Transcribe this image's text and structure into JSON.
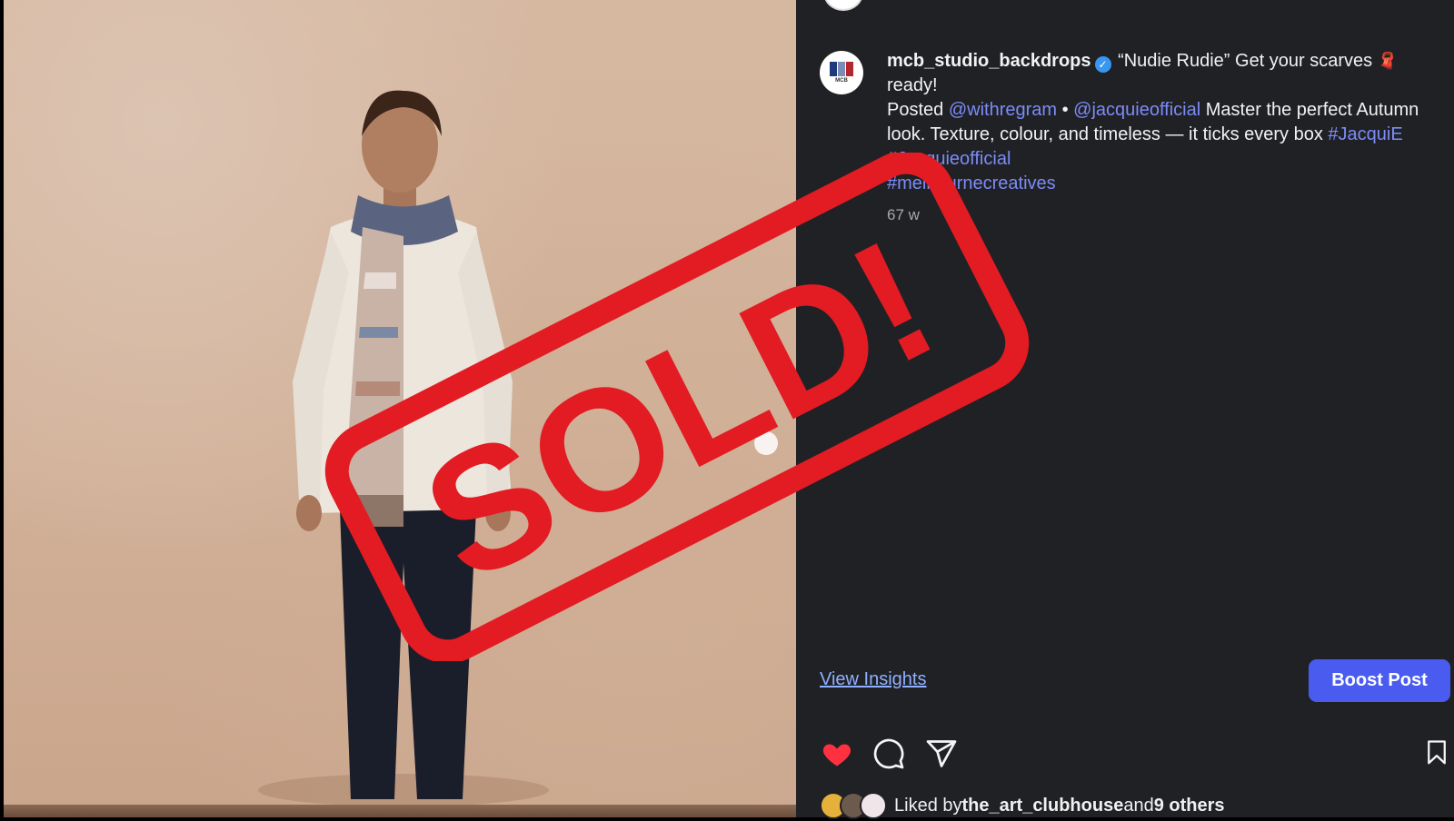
{
  "post": {
    "username": "mcb_studio_backdrops",
    "caption_lead": " “Nudie Rudie” Get your scarves ",
    "caption_tail": "ready!",
    "posted_word": "Posted ",
    "mention_1": "@withregram",
    "separator": " • ",
    "mention_2": "@jacquieofficial",
    "body_text": " Master the perfect Autumn look. Texture, colour, and timeless — it ticks every ",
    "body_text_2": "box ",
    "hashtag_1": "#JacquiE",
    "hashtag_2": "#Jacquieofficial",
    "hashtag_3": "#melbournecreatives",
    "time_ago": "67 w"
  },
  "avatar": {
    "monogram": "MCB",
    "colors": [
      "#1f3a7a",
      "#7a8bb5",
      "#b3262e"
    ]
  },
  "actions": {
    "view_insights": "View Insights",
    "boost_post": "Boost Post",
    "icons": [
      "heart-icon",
      "comment-icon",
      "share-icon",
      "bookmark-icon"
    ],
    "heart_color": "#ff3040"
  },
  "likes": {
    "prefix": "Liked by ",
    "user": "the_art_clubhouse",
    "middle": " and ",
    "others": "9 others"
  },
  "stamp": {
    "text": "SOLD!",
    "color": "#e31b23"
  },
  "colors": {
    "panel_bg": "#202125",
    "link": "#7c8cf8",
    "boost_bg": "#4a5cf0"
  }
}
